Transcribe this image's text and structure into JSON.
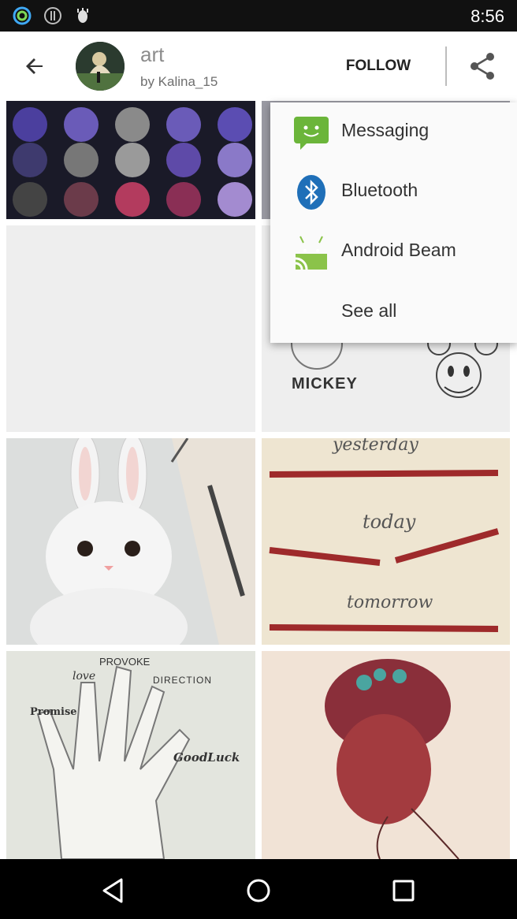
{
  "status_bar": {
    "time": "8:56",
    "icons": [
      "ring-app-icon",
      "vpn-icon",
      "debug-icon"
    ]
  },
  "app_bar": {
    "board_title": "art",
    "board_owner": "by Kalina_15",
    "follow_label": "FOLLOW",
    "back_icon": "arrow-left-icon",
    "share_icon": "share-icon"
  },
  "share_menu": {
    "items": [
      {
        "label": "Messaging",
        "icon": "messaging-icon"
      },
      {
        "label": "Bluetooth",
        "icon": "bluetooth-icon"
      },
      {
        "label": "Android Beam",
        "icon": "android-beam-icon"
      },
      {
        "label": "See all"
      }
    ]
  },
  "pins": [
    {
      "name": "moon-phases"
    },
    {
      "name": "blank"
    },
    {
      "name": "mickey-sketch",
      "caption": "MICKEY"
    },
    {
      "name": "bunny-drawing"
    },
    {
      "name": "pencils-drawing",
      "lines": [
        "yesterday",
        "today",
        "tomorrow"
      ]
    },
    {
      "name": "hand-drawing",
      "words": [
        "PROVOKE",
        "love",
        "DIRECTION",
        "Promise",
        "GoodLuck"
      ]
    },
    {
      "name": "girl-bun-drawing"
    }
  ],
  "nav_bar": {
    "icons": [
      "back-triangle-icon",
      "home-circle-icon",
      "recents-square-icon"
    ]
  },
  "colors": {
    "status_bar_bg": "#111111",
    "nav_bar_bg": "#000000",
    "follow_text": "#222222",
    "menu_bg": "#fafafa",
    "messaging_green": "#6bb53a",
    "bluetooth_blue": "#1f6fb8",
    "android_green": "#8bc34a"
  }
}
